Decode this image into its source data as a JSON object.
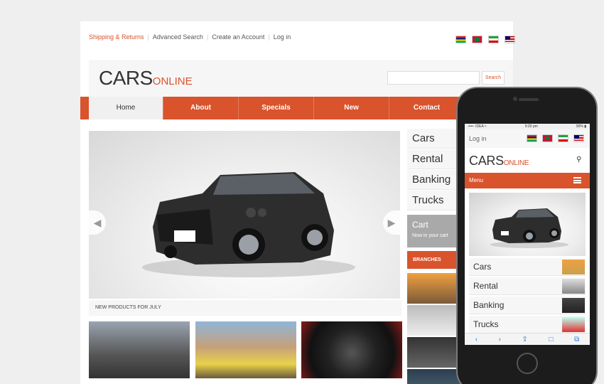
{
  "toplinks": [
    "Shipping & Returns",
    "Advanced Search",
    "Create an Account",
    "Log in"
  ],
  "header": {
    "logo_main": "CARS",
    "logo_sub": "ONLINE",
    "search_label": "Search",
    "search_placeholder": ""
  },
  "nav": [
    "Home",
    "About",
    "Specials",
    "New",
    "Contact"
  ],
  "slider": {
    "prev_icon": "◀",
    "next_icon": "▶"
  },
  "sidebar": {
    "categories": [
      "Cars",
      "Rental",
      "Banking",
      "Trucks"
    ],
    "cart_title": "Cart",
    "cart_text": "Now in your cart",
    "branches": "BRANCHES"
  },
  "new_products": "NEW PRODUCTS FOR JULY",
  "colors": {
    "accent": "#d9532c",
    "nav_active": "#f0f0f0",
    "cart_bg": "#a9a9a9"
  },
  "phone": {
    "status_carrier": "••••◦ IDEA ≈",
    "status_time": "9:20 pm",
    "status_battery": "90% ▮",
    "login": "Log in",
    "logo_main": "CARS",
    "logo_sub": "ONLINE",
    "menu": "Menu",
    "categories": [
      "Cars",
      "Rental",
      "Banking",
      "Trucks"
    ],
    "toolbar": [
      "‹",
      "›",
      "⇪",
      "□",
      "⧉"
    ]
  }
}
